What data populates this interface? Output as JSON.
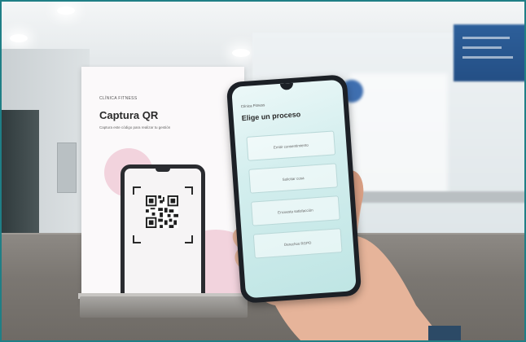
{
  "stand": {
    "label": "CLÍNICA FITNESS",
    "title": "Captura QR",
    "subtitle": "Captura este código para realizar tu gestión"
  },
  "phone": {
    "label": "Clínica Fitness",
    "title": "Elige un proceso",
    "options": [
      {
        "label": "Emitir consentimiento"
      },
      {
        "label": "Solicitar cosa"
      },
      {
        "label": "Encuesta satisfacción"
      },
      {
        "label": "Derechos RGPD"
      }
    ]
  },
  "colors": {
    "frame": "#1f7f86",
    "screen": "#cdeceb",
    "accent_pink": "#f2d3dd"
  }
}
